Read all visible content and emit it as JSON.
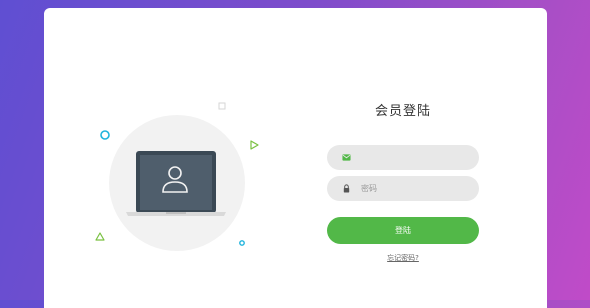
{
  "page": {
    "background_colors": [
      "#5f4fd2",
      "#c04bc8"
    ]
  },
  "login": {
    "title": "会员登陆",
    "email": {
      "icon": "envelope-icon",
      "value": "",
      "placeholder": ""
    },
    "password": {
      "icon": "lock-icon",
      "value": "",
      "placeholder": "密码"
    },
    "submit_label": "登陆",
    "forgot_label": "忘记密码?"
  },
  "illustration": {
    "icon": "user-icon",
    "device": "laptop-icon"
  },
  "colors": {
    "accent": "#52b848",
    "input_bg": "#e8e8e8",
    "cyan": "#1fb3dc",
    "illus_circle": "#f2f2f2",
    "laptop_body": "#3b4955",
    "laptop_screen": "#4f5e6c"
  }
}
